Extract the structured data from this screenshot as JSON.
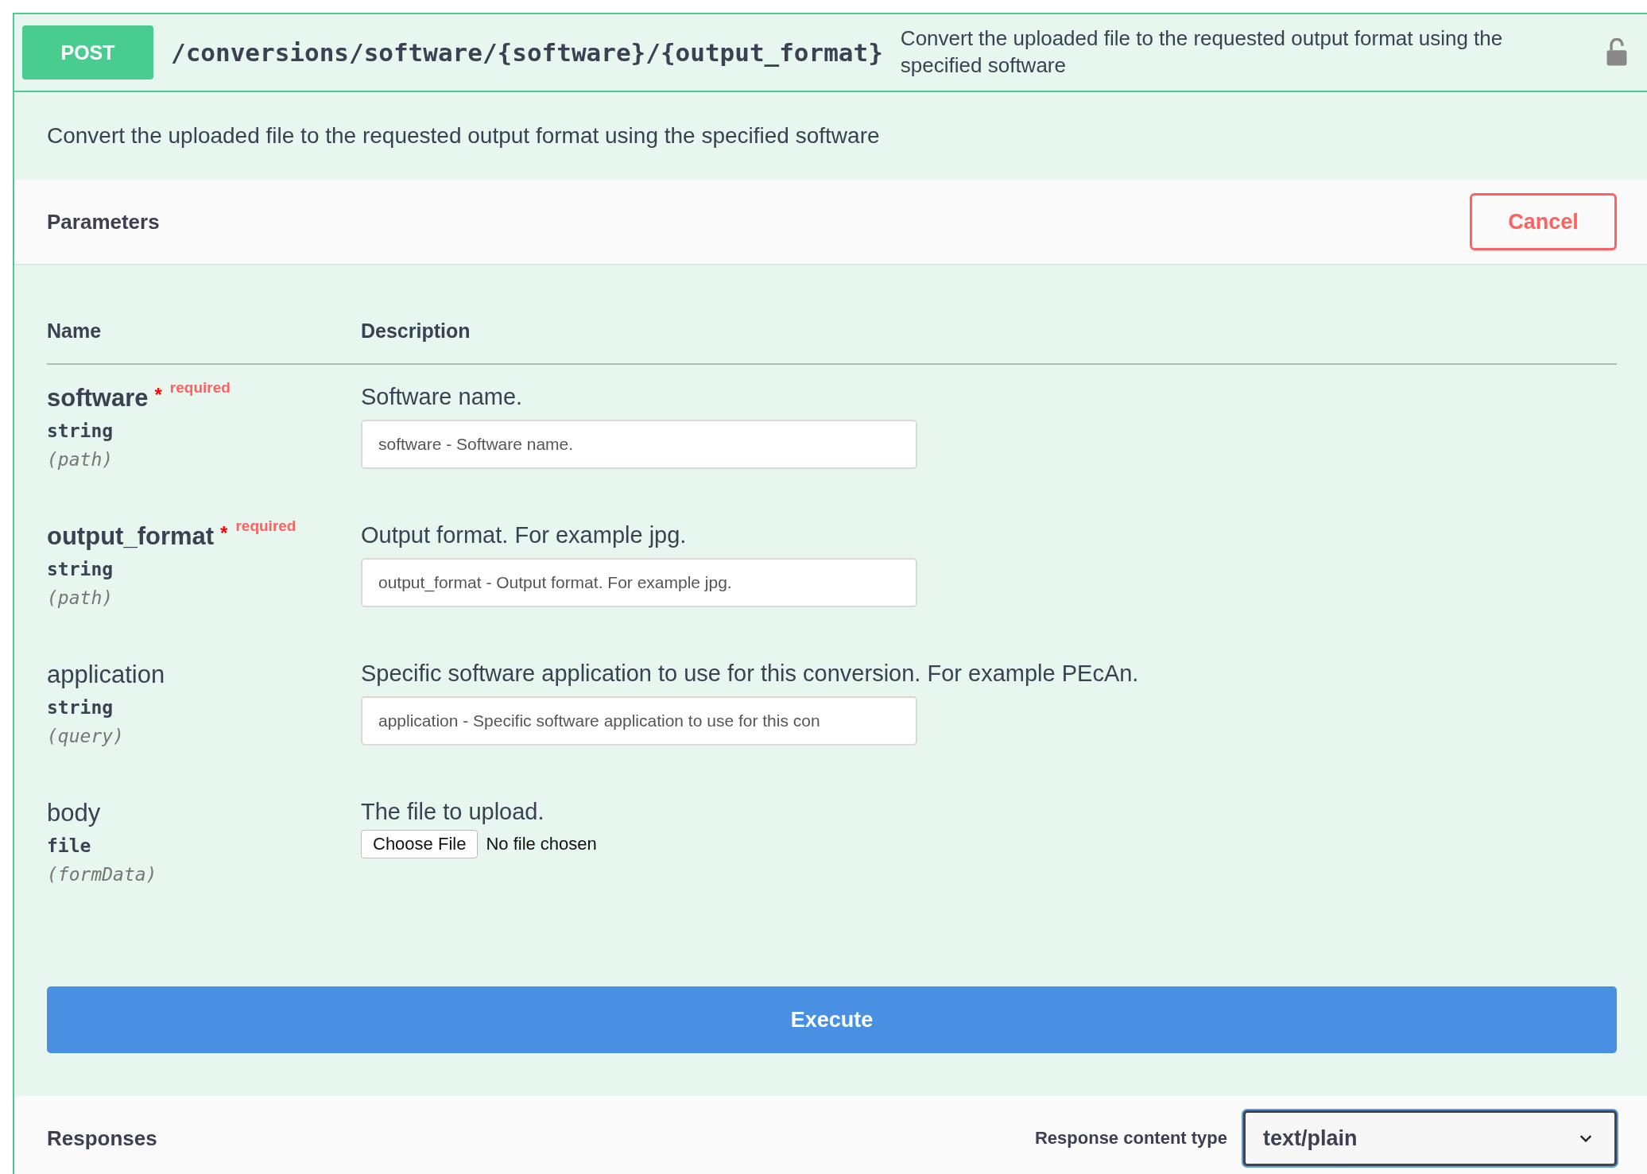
{
  "operation": {
    "method": "POST",
    "path": "/conversions/software/{software}/{output_format}",
    "summary": "Convert the uploaded file to the requested output format using the specified software",
    "locked": false
  },
  "description": "Convert the uploaded file to the requested output format using the specified software",
  "parameters": {
    "title": "Parameters",
    "cancel_button": "Cancel",
    "columns": [
      "Name",
      "Description"
    ],
    "rows": [
      {
        "kind": "text",
        "name": "software",
        "required": true,
        "required_mark": "*",
        "required_label": "required",
        "type": "string",
        "location": "(path)",
        "description": "Software name.",
        "placeholder": "software - Software name."
      },
      {
        "kind": "text",
        "name": "output_format",
        "required": true,
        "required_mark": "*",
        "required_label": "required",
        "type": "string",
        "location": "(path)",
        "description": "Output format. For example jpg.",
        "placeholder": "output_format - Output format. For example jpg."
      },
      {
        "kind": "text",
        "name": "application",
        "required": false,
        "type": "string",
        "location": "(query)",
        "description": "Specific software application to use for this conversion. For example PEcAn.",
        "placeholder": "application - Specific software application to use for this con"
      },
      {
        "kind": "file",
        "name": "body",
        "required": false,
        "type": "file",
        "location": "(formData)",
        "description": "The file to upload.",
        "button": "Choose File",
        "status": "No file chosen"
      }
    ]
  },
  "execute_button": "Execute",
  "responses": {
    "title": "Responses",
    "content_type_label": "Response content type",
    "content_type": "text/plain"
  }
}
